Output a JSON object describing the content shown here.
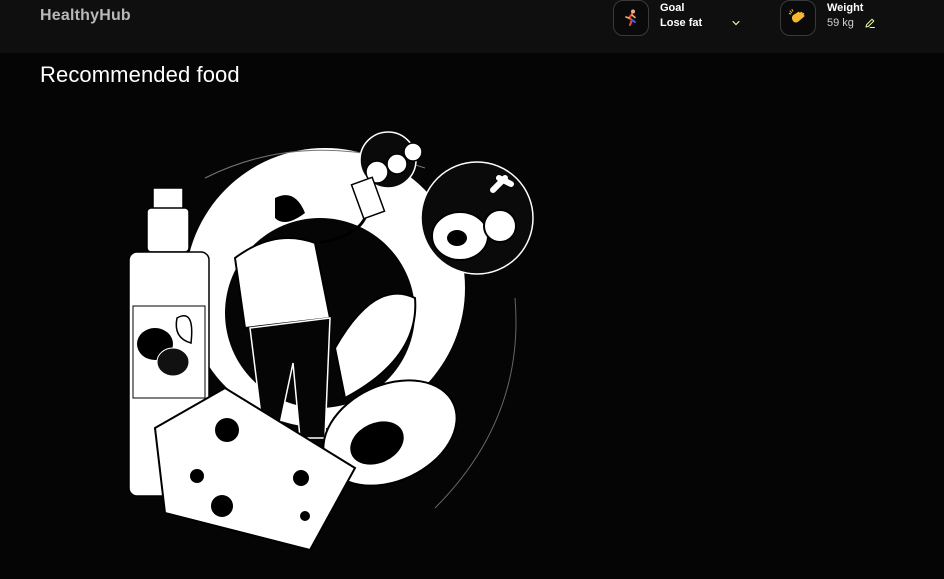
{
  "app": {
    "logo": "HealthyHub"
  },
  "header": {
    "goal": {
      "label": "Goal",
      "value": "Lose fat",
      "icon": "running-person-icon"
    },
    "weight": {
      "label": "Weight",
      "value": "59 kg",
      "icon": "waving-hand-icon"
    }
  },
  "main": {
    "title": "Recommended food",
    "illustration": "woman-with-healthy-food-illustration"
  },
  "colors": {
    "header_bg": "#0f0f0f",
    "page_bg": "#050505",
    "accent": "#e3ffa8",
    "text": "#ffffff"
  }
}
